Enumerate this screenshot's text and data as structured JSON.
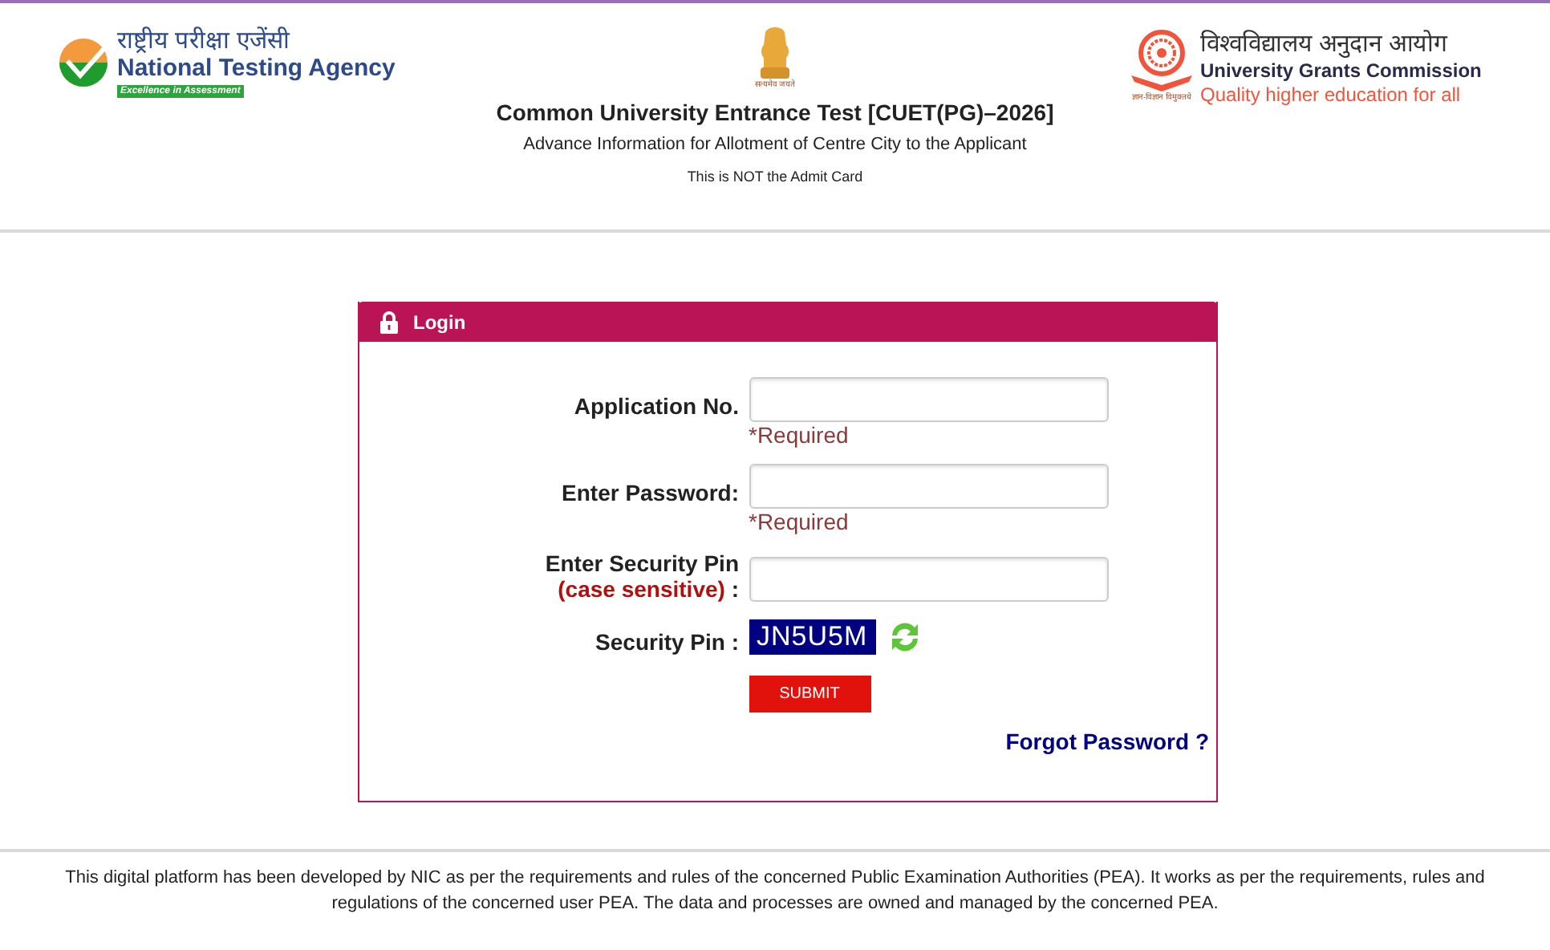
{
  "header": {
    "nta_logo": {
      "hindi": "राष्ट्रीय परीक्षा एजेंसी",
      "name": "National Testing Agency",
      "tagline": "Excellence in Assessment"
    },
    "emblem": {
      "motto": "सत्यमेव जयते"
    },
    "title": "Common University Entrance Test [CUET(PG)–2026]",
    "subtitle": "Advance Information for Allotment of Centre City to the Applicant",
    "note": "This is NOT the Admit Card",
    "ugc_logo": {
      "hindi": "विश्वविद्यालय अनुदान आयोग",
      "name": "University Grants Commission",
      "tagline": "Quality higher education for all",
      "motto": "ज्ञान-विज्ञान विमुक्तये"
    }
  },
  "login": {
    "title": "Login",
    "fields": [
      {
        "label": "Application No.",
        "hint": "*Required"
      },
      {
        "label": "Enter Password:",
        "hint": "*Required"
      },
      {
        "label": "Enter Security Pin",
        "sublabel": "(case sensitive)",
        "suffix": ":"
      }
    ],
    "captcha": {
      "label": "Security Pin :",
      "code": "JN5U5M"
    },
    "submit": "SUBMIT",
    "forgot": "Forgot Password ?"
  },
  "footer": "This digital platform has been developed by NIC as per the requirements and rules of the concerned Public Examination Authorities (PEA). It works as per the requirements, rules and regulations of the concerned user PEA. The data and processes are owned and managed by the concerned PEA."
}
